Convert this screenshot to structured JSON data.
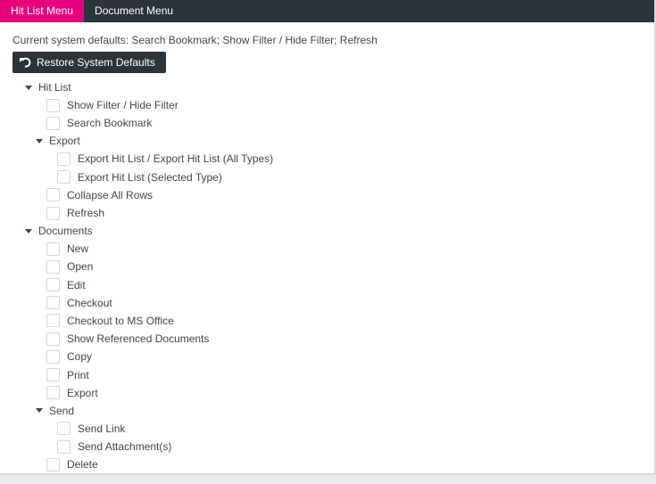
{
  "tabs": [
    {
      "label": "Hit List Menu",
      "active": true
    },
    {
      "label": "Document Menu",
      "active": false
    }
  ],
  "defaults_text": "Current system defaults: Search Bookmark; Show Filter / Hide Filter; Refresh",
  "restore_button": {
    "label": "Restore System Defaults",
    "icon": "undo-icon"
  },
  "tree": {
    "hit_list": {
      "label": "Hit List",
      "items": [
        {
          "label": "Show Filter / Hide Filter",
          "checked": false
        },
        {
          "label": "Search Bookmark",
          "checked": false
        }
      ],
      "export": {
        "label": "Export",
        "items": [
          {
            "label": "Export Hit List / Export Hit List (All Types)",
            "checked": false
          },
          {
            "label": "Export Hit List (Selected Type)",
            "checked": false
          }
        ]
      },
      "items_after": [
        {
          "label": "Collapse All Rows",
          "checked": false
        },
        {
          "label": "Refresh",
          "checked": false
        }
      ]
    },
    "documents": {
      "label": "Documents",
      "items": [
        {
          "label": "New",
          "checked": false
        },
        {
          "label": "Open",
          "checked": false
        },
        {
          "label": "Edit",
          "checked": false
        },
        {
          "label": "Checkout",
          "checked": false
        },
        {
          "label": "Checkout to MS Office",
          "checked": false
        },
        {
          "label": "Show Referenced Documents",
          "checked": false
        },
        {
          "label": "Copy",
          "checked": false
        },
        {
          "label": "Print",
          "checked": false
        },
        {
          "label": "Export",
          "checked": false
        }
      ],
      "send": {
        "label": "Send",
        "items": [
          {
            "label": "Send Link",
            "checked": false
          },
          {
            "label": "Send Attachment(s)",
            "checked": false
          }
        ]
      },
      "items_after": [
        {
          "label": "Delete",
          "checked": false
        }
      ]
    }
  },
  "colors": {
    "accent": "#e6007e",
    "dark": "#2b333b"
  }
}
